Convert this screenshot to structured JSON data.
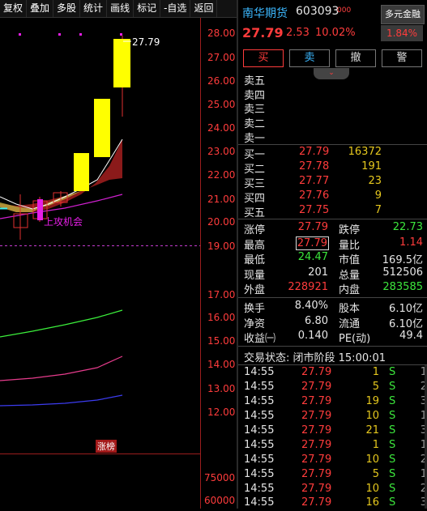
{
  "toolbar": {
    "items": [
      "复权",
      "叠加",
      "多股",
      "统计",
      "画线",
      "标记",
      "-自选",
      "返回"
    ]
  },
  "chart": {
    "price_axis": [
      "28.00",
      "27.00",
      "26.00",
      "25.00",
      "24.00",
      "23.00",
      "22.00",
      "21.00",
      "20.00",
      "19.00",
      "17.00",
      "16.00",
      "15.00",
      "14.00",
      "13.00",
      "12.00"
    ],
    "high_label": "27.79",
    "signal_label": "上攻机会",
    "limit_badge": "涨榜",
    "volume_axis": [
      "75000",
      "60000"
    ]
  },
  "header": {
    "stock_name": "南华期货",
    "stock_code": "603093",
    "code_suffix": "000",
    "multi_button": "多元金融",
    "price": "27.79",
    "change": "2.53",
    "change_pct": "10.02%",
    "box_pct": "1.84%"
  },
  "actions": {
    "buy": "买",
    "sell": "卖",
    "cancel": "撤",
    "alert": "警"
  },
  "ask_rows": [
    {
      "label": "卖五"
    },
    {
      "label": "卖四"
    },
    {
      "label": "卖三"
    },
    {
      "label": "卖二"
    },
    {
      "label": "卖一"
    }
  ],
  "bid_rows": [
    {
      "label": "买一",
      "price": "27.79",
      "vol": "16372"
    },
    {
      "label": "买二",
      "price": "27.78",
      "vol": "191"
    },
    {
      "label": "买三",
      "price": "27.77",
      "vol": "23"
    },
    {
      "label": "买四",
      "price": "27.76",
      "vol": "9"
    },
    {
      "label": "买五",
      "price": "27.75",
      "vol": "7"
    }
  ],
  "stats": {
    "limit_up_label": "涨停",
    "limit_up": "27.79",
    "limit_down_label": "跌停",
    "limit_down": "22.73",
    "high_label": "最高",
    "high": "27.79",
    "vol_ratio_label": "量比",
    "vol_ratio": "1.14",
    "low_label": "最低",
    "low": "24.47",
    "mkt_cap_label": "市值",
    "mkt_cap": "169.5亿",
    "cur_vol_label": "现量",
    "cur_vol": "201",
    "total_vol_label": "总量",
    "total_vol": "512506",
    "outer_label": "外盘",
    "outer": "228921",
    "inner_label": "内盘",
    "inner": "283585",
    "turnover_label": "换手",
    "turnover": "8.40%",
    "share_cap_label": "股本",
    "share_cap": "6.10亿",
    "nav_label": "净资",
    "nav": "6.80",
    "float_label": "流通",
    "float": "6.10亿",
    "eps_label": "收益㈠",
    "eps": "0.140",
    "pe_label": "PE(动)",
    "pe": "49.4"
  },
  "trade_status": "交易状态: 闭市阶段 15:00:01",
  "ticks": [
    {
      "time": "14:55",
      "price": "27.79",
      "vol": "1",
      "side": "S",
      "n": "1"
    },
    {
      "time": "14:55",
      "price": "27.79",
      "vol": "5",
      "side": "S",
      "n": "2"
    },
    {
      "time": "14:55",
      "price": "27.79",
      "vol": "19",
      "side": "S",
      "n": "3"
    },
    {
      "time": "14:55",
      "price": "27.79",
      "vol": "10",
      "side": "S",
      "n": "1"
    },
    {
      "time": "14:55",
      "price": "27.79",
      "vol": "21",
      "side": "S",
      "n": "3"
    },
    {
      "time": "14:55",
      "price": "27.79",
      "vol": "1",
      "side": "S",
      "n": "1"
    },
    {
      "time": "14:55",
      "price": "27.79",
      "vol": "10",
      "side": "S",
      "n": "2"
    },
    {
      "time": "14:55",
      "price": "27.79",
      "vol": "5",
      "side": "S",
      "n": "1"
    },
    {
      "time": "14:55",
      "price": "27.79",
      "vol": "10",
      "side": "S",
      "n": "2"
    },
    {
      "time": "14:55",
      "price": "27.79",
      "vol": "16",
      "side": "S",
      "n": "3"
    }
  ]
}
